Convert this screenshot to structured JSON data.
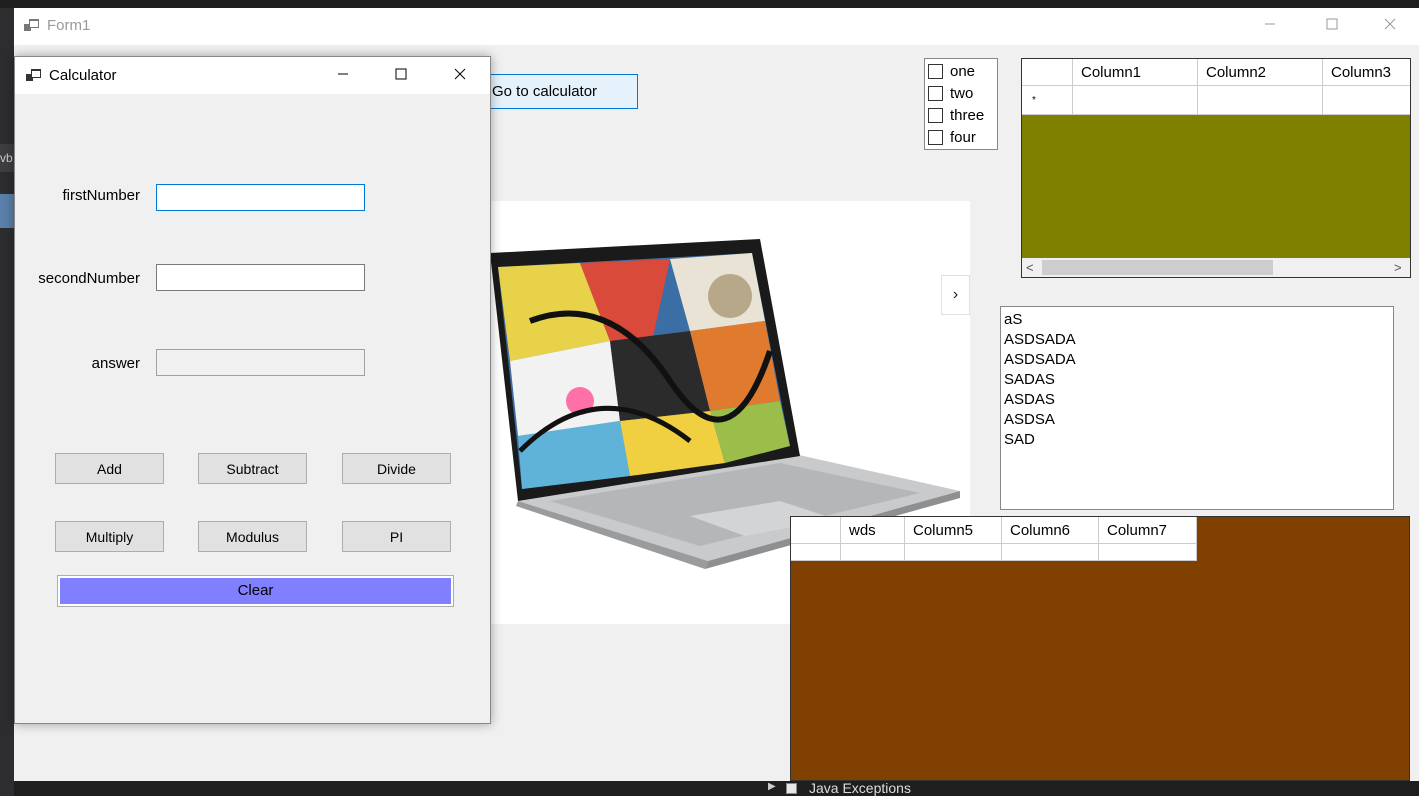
{
  "form1": {
    "title": "Form1",
    "goto_button": "Go to calculator",
    "next_button": "›",
    "checklist": [
      "one",
      "two",
      "three",
      "four"
    ],
    "grid1": {
      "columns": [
        "Column1",
        "Column2",
        "Column3"
      ],
      "new_row_marker": "*",
      "background_color": "#808000"
    },
    "listbox": [
      "aS",
      "ASDSADA",
      "ASDSADA",
      "SADAS",
      "ASDAS",
      "ASDSA",
      "SAD"
    ],
    "grid2": {
      "columns": [
        "wds",
        "Column5",
        "Column6",
        "Column7"
      ],
      "background_color": "#804000"
    }
  },
  "calculator": {
    "title": "Calculator",
    "labels": {
      "first": "firstNumber",
      "second": "secondNumber",
      "answer": "answer"
    },
    "inputs": {
      "first": "",
      "second": "",
      "answer": ""
    },
    "buttons": {
      "add": "Add",
      "subtract": "Subtract",
      "divide": "Divide",
      "multiply": "Multiply",
      "modulus": "Modulus",
      "pi": "PI",
      "clear": "Clear"
    },
    "clear_color": "#8080ff"
  },
  "ide": {
    "left_tab_text": "vb",
    "bottom_item": "Java Exceptions"
  },
  "caption_icons": [
    "minimize-icon",
    "maximize-icon",
    "close-icon"
  ]
}
